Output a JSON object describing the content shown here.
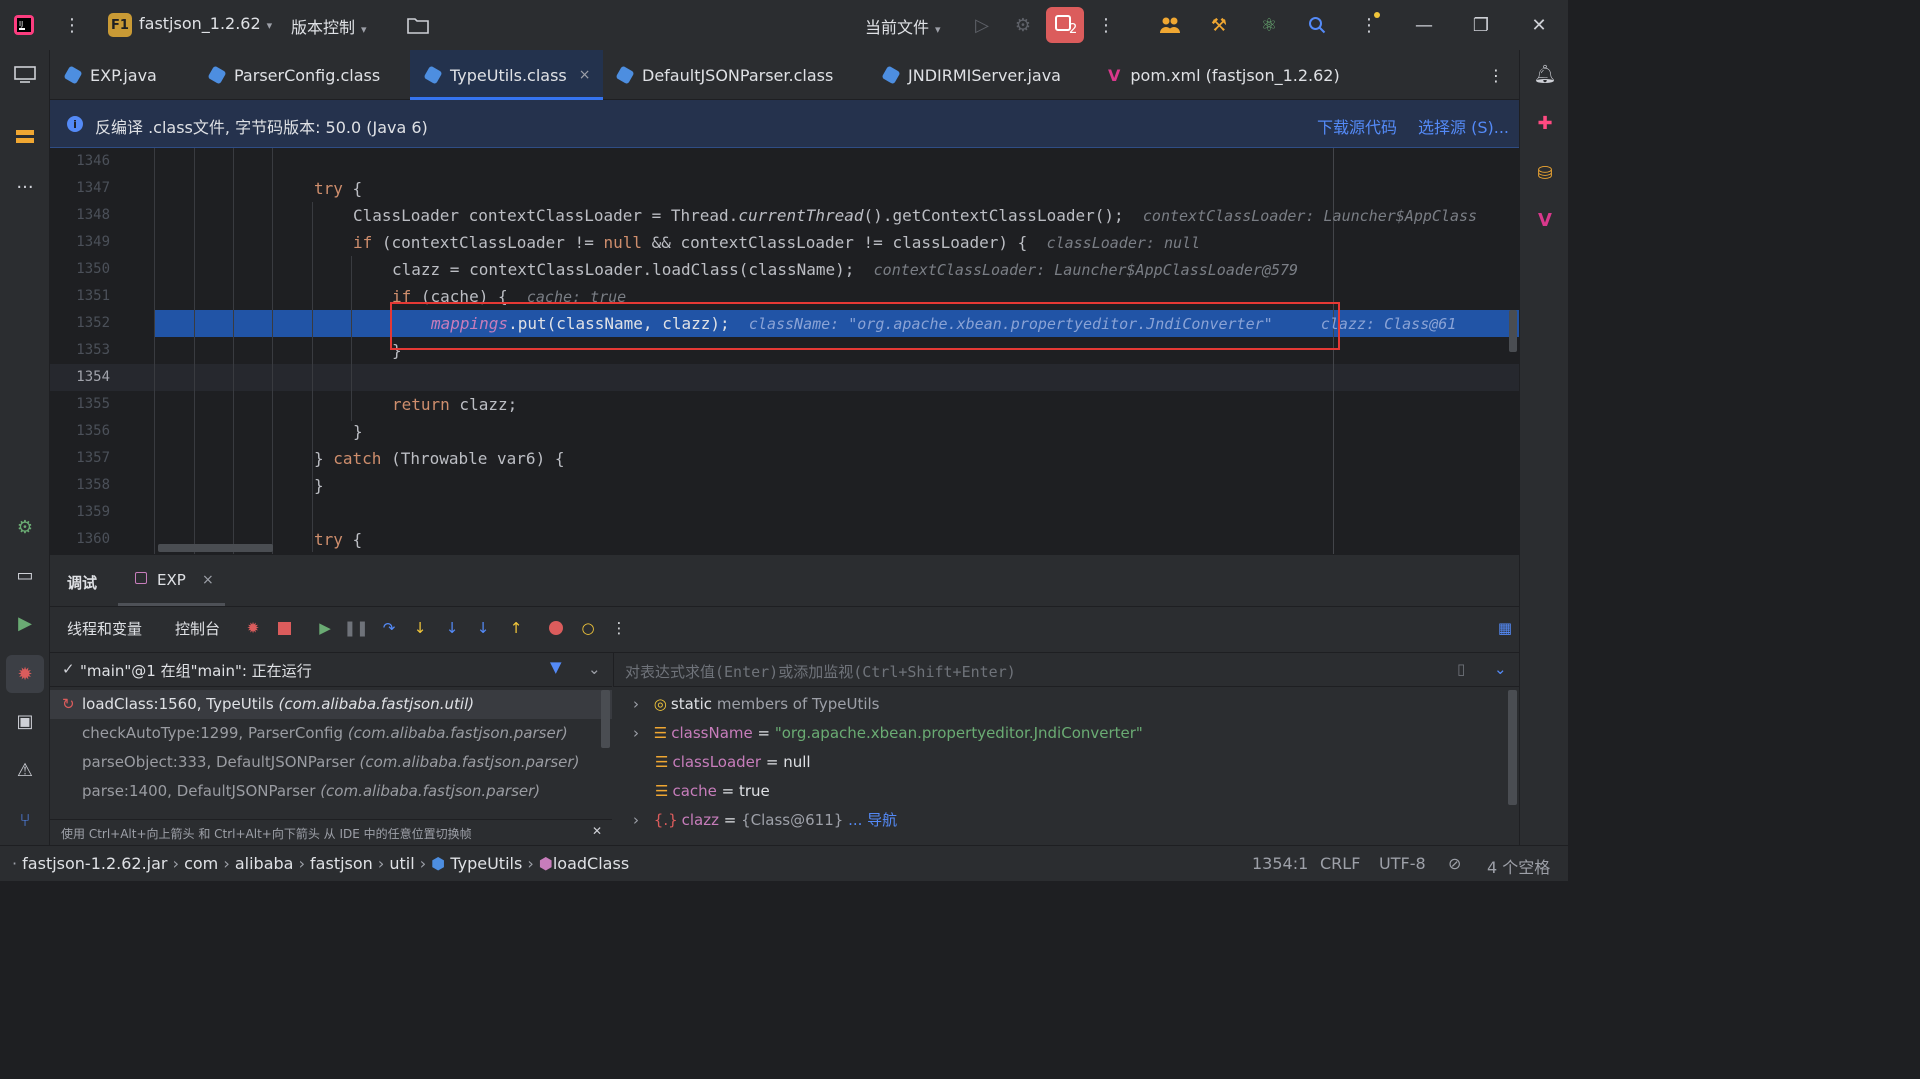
{
  "titlebar": {
    "project_badge": "F1",
    "project_name": "fastjson_1.2.62",
    "vcs_label": "版本控制",
    "run_config": "当前文件",
    "problems_count": "2"
  },
  "tabs": [
    {
      "label": "EXP.java"
    },
    {
      "label": "ParserConfig.class"
    },
    {
      "label": "TypeUtils.class",
      "close": "×"
    },
    {
      "label": "DefaultJSONParser.class"
    },
    {
      "label": "JNDIRMIServer.java"
    },
    {
      "label": "pom.xml (fastjson_1.2.62)"
    }
  ],
  "banner": {
    "text": "反编译 .class文件, 字节码版本: 50.0 (Java 6)",
    "download_link": "下载源代码",
    "choose_link": "选择源 (S)..."
  },
  "editor": {
    "line_numbers": [
      "1346",
      "1347",
      "1348",
      "1349",
      "1350",
      "1351",
      "1352",
      "1353",
      "1354",
      "1355",
      "1356",
      "1357",
      "1358",
      "1359",
      "1360"
    ],
    "hints": {
      "h1348": "contextClassLoader: Launcher$AppClass",
      "h1349": "classLoader: null",
      "h1350": "contextClassLoader: Launcher$AppClassLoader@579",
      "h1351": "cache: true",
      "h1352a": "className: \"org.apache.xbean.propertyeditor.JndiConverter\"",
      "h1352b": "clazz: Class@61"
    }
  },
  "debug": {
    "title": "调试",
    "session_tab": "EXP",
    "session_close": "×",
    "sub_tabs": [
      "线程和变量",
      "控制台"
    ],
    "thread": "\"main\"@1 在组\"main\": 正在运行",
    "expression_placeholder": "对表达式求值(Enter)或添加监视(Ctrl+Shift+Enter)",
    "frames": [
      {
        "method": "loadClass:1560, TypeUtils",
        "pkg": "(com.alibaba.fastjson.util)"
      },
      {
        "method": "checkAutoType:1299, ParserConfig",
        "pkg": "(com.alibaba.fastjson.parser)"
      },
      {
        "method": "parseObject:333, DefaultJSONParser",
        "pkg": "(com.alibaba.fastjson.parser)"
      },
      {
        "method": "parse:1400, DefaultJSONParser",
        "pkg": "(com.alibaba.fastjson.parser)"
      }
    ],
    "frame_tip": "使用 Ctrl+Alt+向上箭头 和 Ctrl+Alt+向下箭头 从 IDE 中的任意位置切换帧",
    "vars": {
      "static_kw": "static",
      "static_rest": "members of TypeUtils",
      "className_name": "className",
      "className_val": "\"org.apache.xbean.propertyeditor.JndiConverter\"",
      "classLoader_name": "classLoader",
      "classLoader_val": "null",
      "cache_name": "cache",
      "cache_val": "true",
      "clazz_name": "clazz",
      "clazz_val": "{Class@611}",
      "clazz_link": "... 导航",
      "eq": " = "
    }
  },
  "statusbar": {
    "crumbs": [
      "fastjson-1.2.62.jar",
      "com",
      "alibaba",
      "fastjson",
      "util",
      "TypeUtils",
      "loadClass"
    ],
    "position": "1354:1",
    "line_sep": "CRLF",
    "encoding": "UTF-8",
    "indent": "4 个空格"
  }
}
